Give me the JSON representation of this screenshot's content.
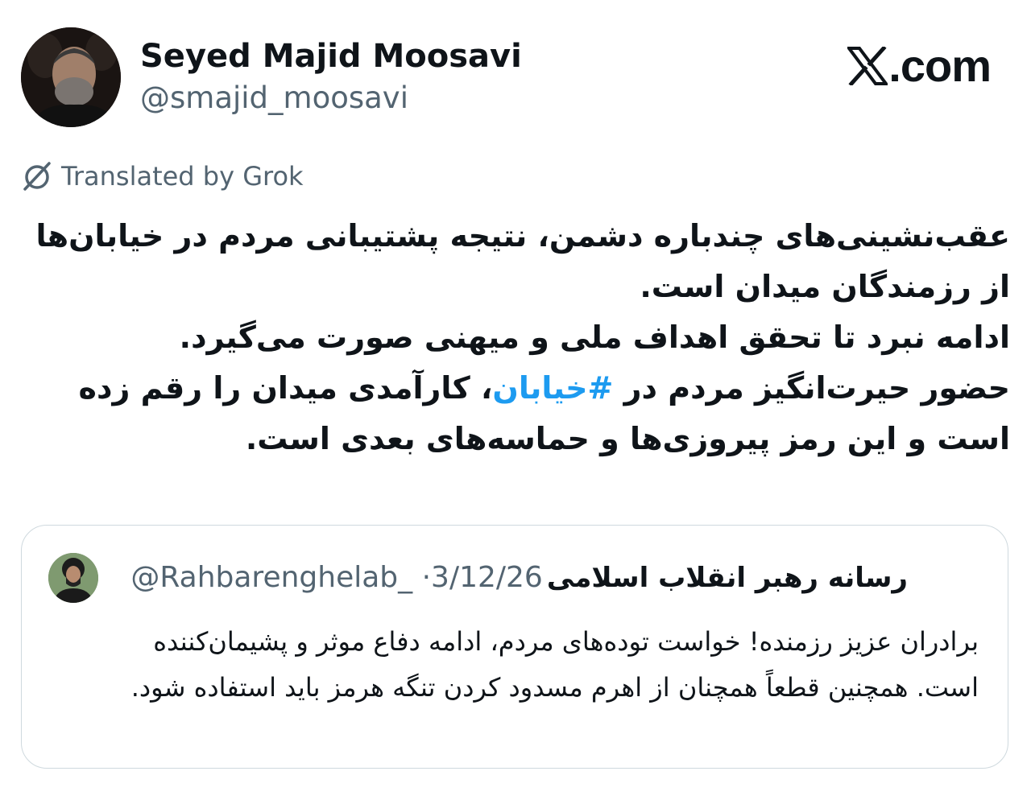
{
  "author": {
    "name": "Seyed Majid Moosavi",
    "handle": "@smajid_moosavi",
    "avatar_icon": "profile-photo"
  },
  "site": {
    "label": ".com",
    "logo_icon": "x-logo-icon"
  },
  "translation": {
    "label": "Translated by Grok",
    "icon": "grok-icon"
  },
  "tweet": {
    "line1": "عقب‌نشینی‌های چندباره دشمن، نتیجه پشتیبانی مردم در خیابان‌ها از رزمندگان میدان است.",
    "line2": "ادامه نبرد تا تحقق اهداف ملی و میهنی صورت می‌گیرد.",
    "line3_before": "حضور حیرت‌انگیز مردم در ",
    "hashtag": "#خیابان",
    "line3_after": "، کارآمدی میدان را رقم زده است و این رمز پیروزی‌ها و حماسه‌های بعدی است."
  },
  "quoted_tweet": {
    "name": "رسانه رهبر انقلاب اسلامی",
    "handle": "@Rahbarenghelab_",
    "separator": "·",
    "date": "3/12/26",
    "text": "برادران عزیز رزمنده! خواست توده‌های مردم، ادامه دفاع موثر و پشیمان‌کننده است. همچنین قطعاً همچنان از اهرم مسدود کردن تنگه هرمز باید استفاده شود."
  },
  "colors": {
    "text": "#0f1419",
    "secondary": "#536471",
    "link": "#1d9bf0",
    "border": "#cfd9de"
  }
}
